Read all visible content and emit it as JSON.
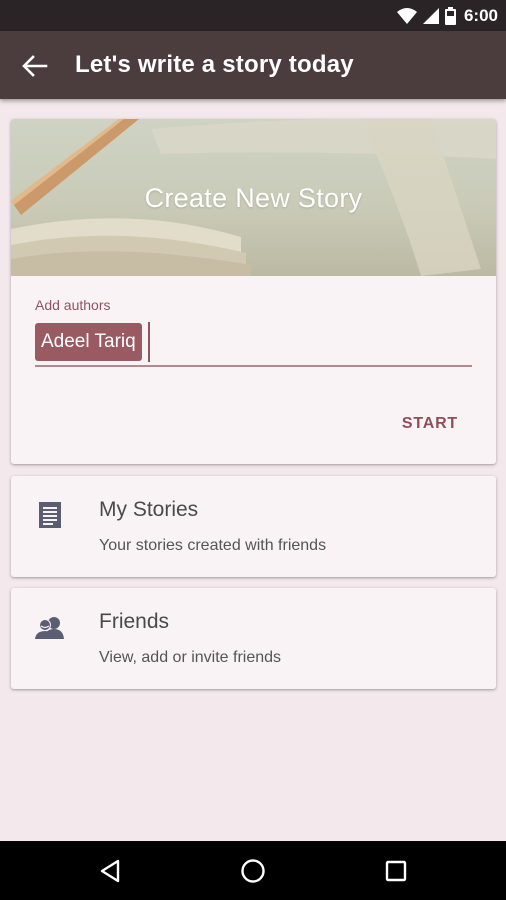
{
  "status_bar": {
    "time": "6:00",
    "icons": [
      "wifi-icon",
      "cell-signal-icon",
      "battery-icon"
    ],
    "background": "#2b2426"
  },
  "toolbar": {
    "title": "Let's write a story today",
    "back_icon": "arrow-left-icon",
    "background": "#4b3d3e"
  },
  "create_card": {
    "title": "Create New Story",
    "authors_label": "Add authors",
    "authors": [
      "Adeel Tariq"
    ],
    "start_label": "START",
    "accent": "#9a5a62"
  },
  "menu": [
    {
      "title": "My Stories",
      "subtitle": "Your stories created with friends",
      "icon": "document-icon"
    },
    {
      "title": "Friends",
      "subtitle": "View, add or invite friends",
      "icon": "people-icon"
    }
  ],
  "nav_bar": {
    "buttons": [
      "back-triangle-icon",
      "home-circle-icon",
      "recents-square-icon"
    ]
  }
}
